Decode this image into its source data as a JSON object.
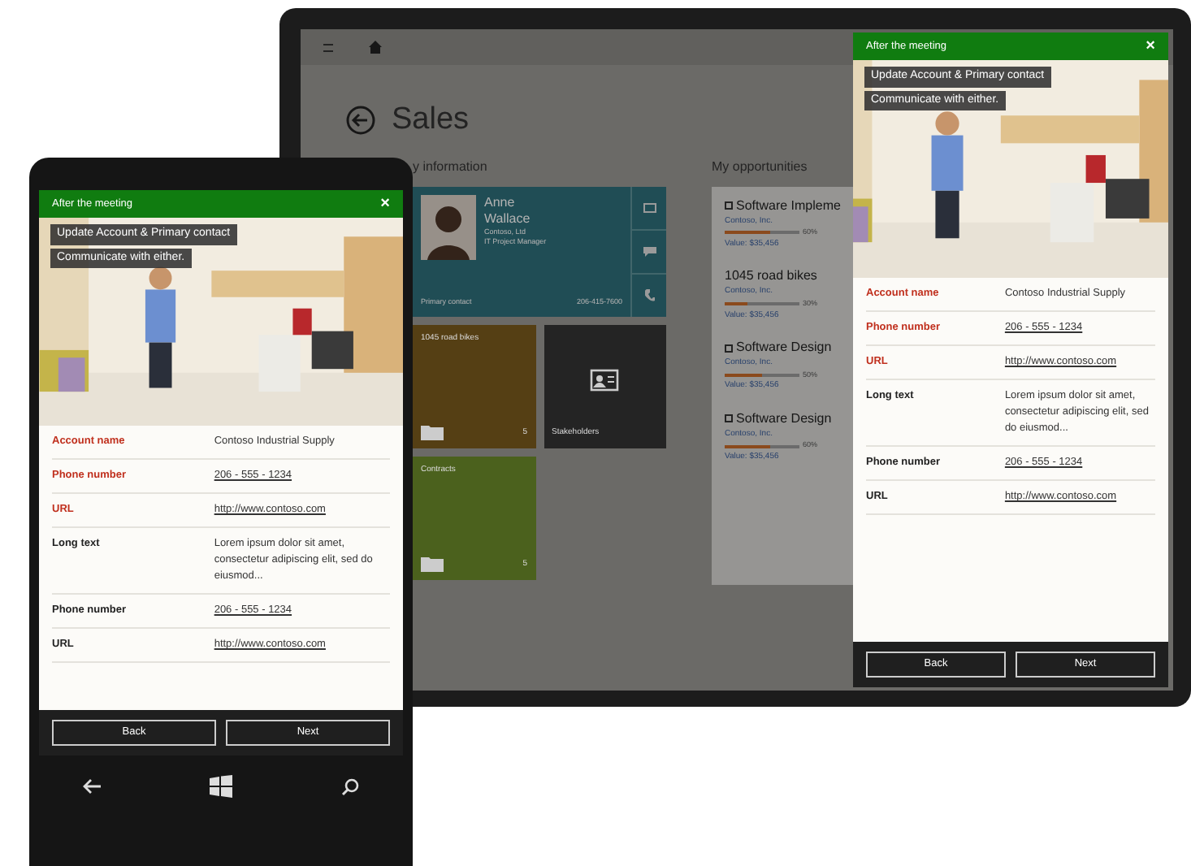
{
  "tablet": {
    "app": {
      "title": "Sales",
      "section_1": "y information",
      "section_2": "My opportunities",
      "contact": {
        "name": "Anne Wallace",
        "company": "Contoso, Ltd",
        "role": "IT Project Manager",
        "footer": "Primary contact",
        "phone": "206-415-7600"
      },
      "tiles": [
        {
          "label": "1045 road bikes",
          "count": "5",
          "color": "#553f14",
          "kind": "folder"
        },
        {
          "label": "Stakeholders",
          "color": "#242424",
          "kind": "card"
        },
        {
          "label": "Contracts",
          "count": "5",
          "color": "#4b611d",
          "kind": "folder"
        }
      ],
      "opportunities": [
        {
          "title": "Software Impleme",
          "icon": true,
          "company": "Contoso, Inc.",
          "level": 0.6,
          "percent": "60%",
          "value": "Value: $35,456"
        },
        {
          "title": "1045 road bikes",
          "icon": false,
          "company": "Contoso, Inc.",
          "level": 0.3,
          "percent": "30%",
          "value": "Value: $35,456"
        },
        {
          "title": "Software Design",
          "icon": true,
          "company": "Contoso, Inc.",
          "level": 0.5,
          "percent": "50%",
          "value": "Value: $35,456"
        },
        {
          "title": "Software Design",
          "icon": true,
          "company": "Contoso, Inc.",
          "level": 0.6,
          "percent": "60%",
          "value": "Value: $35,456"
        }
      ]
    },
    "dialog": {
      "title": "After the meeting",
      "close": "×",
      "captions": [
        "Update Account & Primary contact",
        "Communicate with either."
      ],
      "fields": [
        {
          "label": "Account name",
          "value": "Contoso Industrial Supply",
          "required": true,
          "kind": "text"
        },
        {
          "label": "Phone number",
          "value": "206 - 555 - 1234",
          "required": true,
          "kind": "link"
        },
        {
          "label": "URL",
          "value": "http://www.contoso.com",
          "required": true,
          "kind": "link"
        },
        {
          "label": "Long text",
          "value": "Lorem ipsum dolor sit amet, consectetur adipiscing elit, sed do eiusmod...",
          "required": false,
          "kind": "text"
        },
        {
          "label": "Phone number",
          "value": "206 - 555 - 1234",
          "required": false,
          "kind": "link"
        },
        {
          "label": "URL",
          "value": "http://www.contoso.com",
          "required": false,
          "kind": "link"
        }
      ],
      "buttons": [
        "Back",
        "Next"
      ]
    }
  },
  "phone": {
    "dialog": {
      "title": "After the meeting",
      "close": "×",
      "captions": [
        "Update Account & Primary contact",
        "Communicate with either."
      ],
      "fields": [
        {
          "label": "Account name",
          "value": "Contoso Industrial Supply",
          "required": true,
          "kind": "text"
        },
        {
          "label": "Phone number",
          "value": "206 - 555 - 1234",
          "required": true,
          "kind": "link"
        },
        {
          "label": "URL",
          "value": "http://www.contoso.com",
          "required": true,
          "kind": "link"
        },
        {
          "label": "Long text",
          "value": "Lorem ipsum dolor sit amet, consectetur adipiscing elit, sed do eiusmod...",
          "required": false,
          "kind": "text"
        },
        {
          "label": "Phone number",
          "value": "206 - 555 - 1234",
          "required": false,
          "kind": "link"
        },
        {
          "label": "URL",
          "value": "http://www.contoso.com",
          "required": false,
          "kind": "link"
        }
      ],
      "buttons": [
        "Back",
        "Next"
      ]
    }
  }
}
